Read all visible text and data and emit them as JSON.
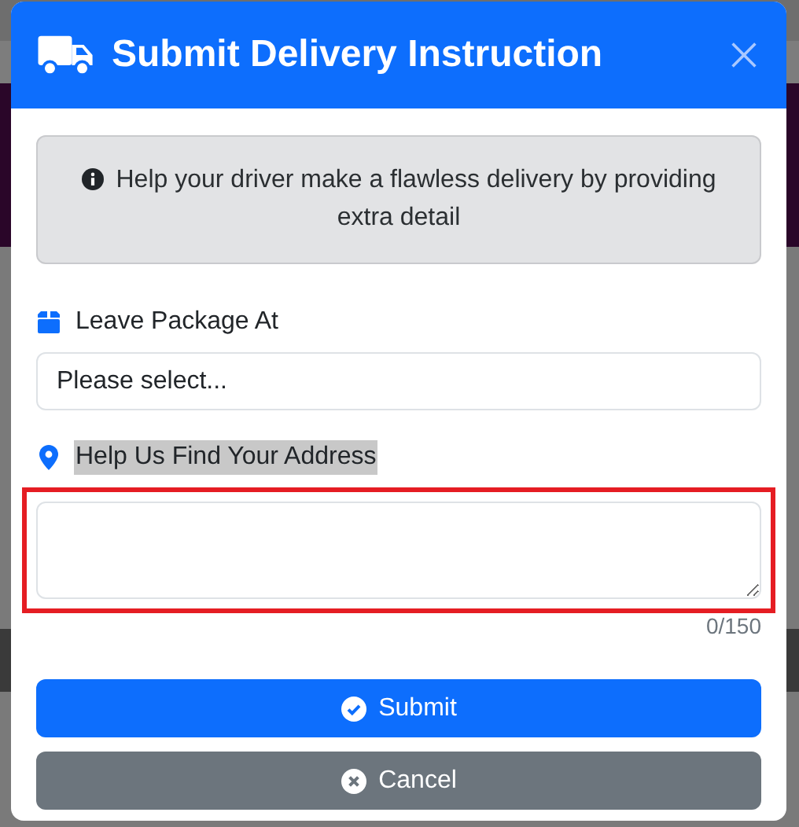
{
  "dialog": {
    "title": "Submit Delivery Instruction"
  },
  "info": "Help your driver make a flawless delivery by providing extra detail",
  "fields": [
    {
      "kind": "select",
      "label": "Leave Package At",
      "value": "Please select...",
      "label_highlighted": false
    },
    {
      "kind": "textarea",
      "label": "Help Us Find Your Address",
      "label_highlighted": true,
      "outlined": true,
      "counter": "0/150"
    }
  ],
  "buttons": [
    {
      "kind": "primary",
      "label": "Submit"
    },
    {
      "kind": "secondary",
      "label": "Cancel"
    }
  ]
}
